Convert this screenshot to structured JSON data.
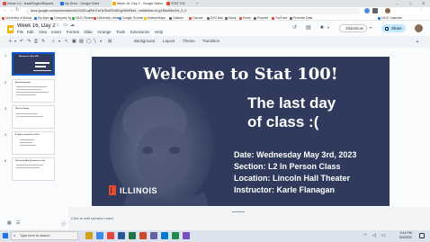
{
  "browser": {
    "tabs": [
      {
        "label": "Home 4.0 - tests/Regex/Reports",
        "color": "#d9534f"
      },
      {
        "label": "My Drive - Google Drive",
        "color": "#1a73e8"
      },
      {
        "label": "Week 16, Day 2 - Google Slides",
        "color": "#f4b400"
      },
      {
        "label": "STAT 100",
        "color": "#e84a27"
      }
    ],
    "new_tab": "+",
    "window_controls": {
      "minimize": "–",
      "maximize": "□",
      "close": "✕"
    },
    "url": "docs.google.com/presentation/d/1SZ5f-ajRbH7wiTcGb45Tc80vg1f5hP8d4.../edit#slide=id.g238a4f8a7b9_0_0",
    "bookmarks": [
      {
        "label": "University of Illinois",
        "color": "#e84a27"
      },
      {
        "label": "My Apps",
        "color": "#1a73e8"
      },
      {
        "label": "Compass 2g",
        "color": "#5f6368"
      },
      {
        "label": "UIUC Reader",
        "color": "#34a853"
      },
      {
        "label": "University Library",
        "color": "#e84a27"
      },
      {
        "label": "Google Scholar",
        "color": "#4285f4"
      },
      {
        "label": "MathonMapp",
        "color": "#fbbc05"
      },
      {
        "label": "Odanee",
        "color": "#5f6368"
      },
      {
        "label": "Canvas",
        "color": "#e84a27"
      },
      {
        "label": "DIGI Nav",
        "color": "#5f6368"
      },
      {
        "label": "Kaiuk",
        "color": "#5f6368"
      },
      {
        "label": "Email",
        "color": "#ea4335"
      },
      {
        "label": "Pinpoint",
        "color": "#5f6368"
      },
      {
        "label": "YouTube",
        "color": "#ea4335"
      },
      {
        "label": "Florence Data",
        "color": "#5f6368"
      },
      {
        "label": "UIUC Calendar",
        "color": "#1a73e8"
      }
    ]
  },
  "doc": {
    "title": "Week 16, Day 2",
    "menu": [
      "File",
      "Edit",
      "View",
      "Insert",
      "Format",
      "Slide",
      "Arrange",
      "Tools",
      "Extensions",
      "Help"
    ],
    "slideshow_label": "Slideshow",
    "share_label": "Share"
  },
  "toolbar": {
    "background_label": "Background",
    "layout_label": "Layout",
    "theme_label": "Theme",
    "transition_label": "Transition"
  },
  "filmstrip": [
    {
      "num": "1",
      "title": "Welcome to Stat 100!",
      "selected": true
    },
    {
      "num": "2",
      "title": "Announcements",
      "selected": false
    },
    {
      "num": "3",
      "title": "Plan for Today",
      "selected": false
    },
    {
      "num": "4",
      "title": "4 Topics should I re-visit?",
      "selected": false
    },
    {
      "num": "5",
      "title": "The last 4 Mini Questions so far",
      "selected": false
    }
  ],
  "slide": {
    "title": "Welcome to Stat 100!",
    "subtitle_line1": "The last day",
    "subtitle_line2": "of class :(",
    "info": [
      {
        "key": "Date:",
        "value": "Wednesday May 3rd, 2023"
      },
      {
        "key": "Section:",
        "value": "L2 In Person Class"
      },
      {
        "key": "Location:",
        "value": "Lincoln Hall Theater"
      },
      {
        "key": "Instructor:",
        "value": "Karle Flanagan"
      }
    ],
    "logo_text": "ILLINOIS"
  },
  "notes_placeholder": "Click to add speaker notes",
  "taskbar": {
    "search_placeholder": "Type here to search",
    "time": "2:41 PM",
    "date": "5/3/2023"
  }
}
